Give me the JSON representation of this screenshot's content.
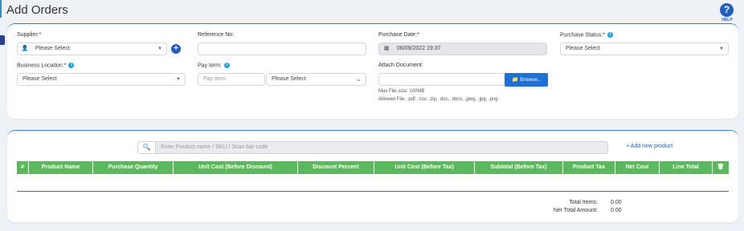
{
  "page": {
    "title": "Add Orders",
    "help_label": "HELP",
    "help_glyph": "?"
  },
  "form": {
    "supplier": {
      "label": "Supplier:*",
      "value": "Please Select"
    },
    "reference_no": {
      "label": "Reference No:",
      "value": ""
    },
    "purchase_date": {
      "label": "Purchase Date:*",
      "value": "06/09/2022 19:37"
    },
    "purchase_status": {
      "label": "Purchase Status:*",
      "value": "Please Select"
    },
    "business_location": {
      "label": "Business Location:*",
      "value": "Please Select"
    },
    "pay_term": {
      "label": "Pay term:",
      "placeholder": "Pay term",
      "unit_value": "Please Select"
    },
    "attach_document": {
      "label": "Attach Document:",
      "browse_label": "Browse..",
      "max_size": "Max File size: 100MB",
      "allowed": "Allowed File: .pdf, .csv, .zip, .doc, .docx, .jpeg, .jpg, .png"
    }
  },
  "products": {
    "search_placeholder": "Enter Product name / SKU / Scan bar code",
    "add_new_label": "+ Add new product",
    "columns": [
      "#",
      "Product Name",
      "Purchase Quantity",
      "Unit Cost (Before Discount)",
      "Discount Percent",
      "Unit Cost (Before Tax)",
      "Subtotal (Before Tax)",
      "Product Tax",
      "Net Cost",
      "Line Total"
    ]
  },
  "totals": {
    "items_label": "Total Items:",
    "items_value": "0.00",
    "net_label": "Net Total Amount:",
    "net_value": "0.00"
  },
  "colors": {
    "accent": "#1e5fbf",
    "table_header": "#5cb85c",
    "info": "#1aa3e0"
  }
}
